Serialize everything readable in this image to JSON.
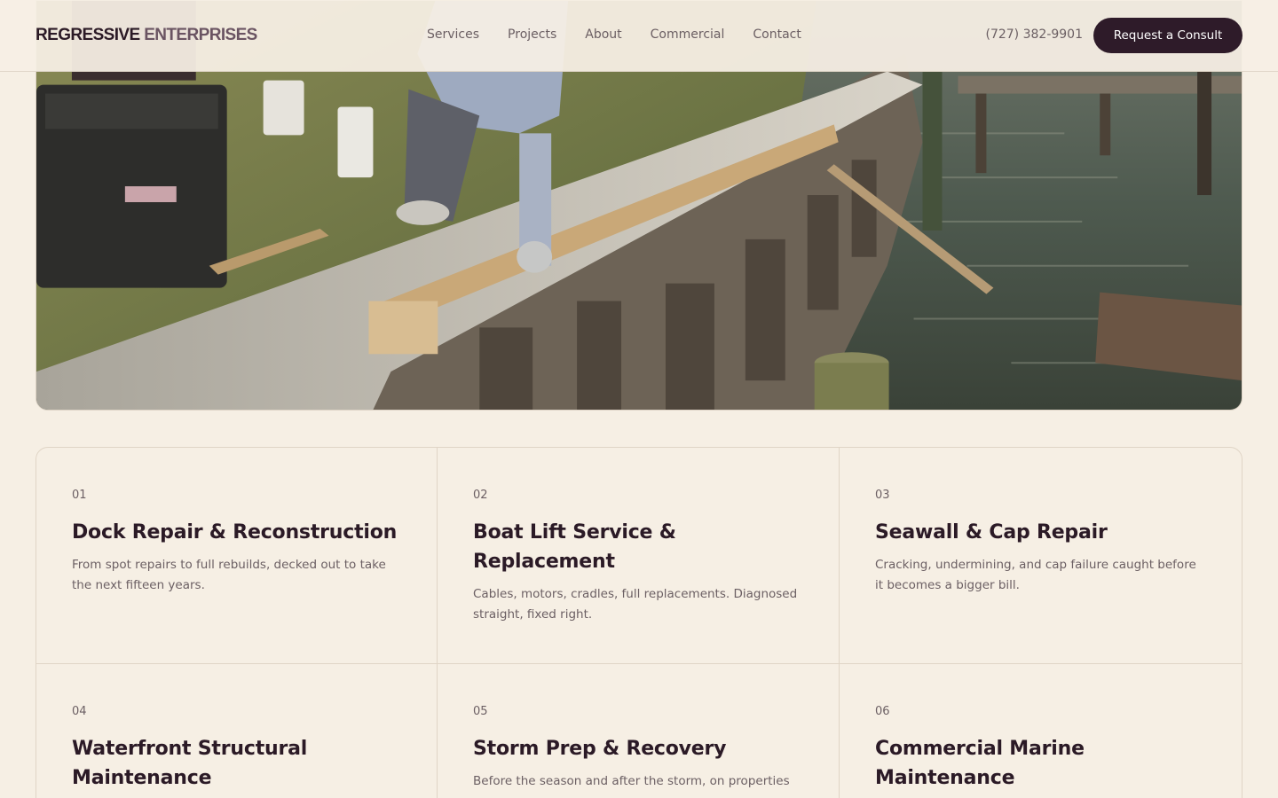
{
  "header": {
    "brand_part1": "REGRESSIVE",
    "brand_part2": "ENTERPRISES",
    "nav": [
      "Services",
      "Projects",
      "About",
      "Commercial",
      "Contact"
    ],
    "phone": "(727) 382-9901",
    "cta_label": "Request a Consult"
  },
  "hero": {
    "image_subject": "seawall-construction-photo"
  },
  "services": [
    {
      "num": "01",
      "title": "Dock Repair & Reconstruction",
      "desc": "From spot repairs to full rebuilds, decked out to take the next fifteen years."
    },
    {
      "num": "02",
      "title": "Boat Lift Service & Replacement",
      "desc": "Cables, motors, cradles, full replacements. Diagnosed straight, fixed right."
    },
    {
      "num": "03",
      "title": "Seawall & Cap Repair",
      "desc": "Cracking, undermining, and cap failure caught before it becomes a bigger bill."
    },
    {
      "num": "04",
      "title": "Waterfront Structural Maintenance",
      "desc": ""
    },
    {
      "num": "05",
      "title": "Storm Prep & Recovery",
      "desc": "Before the season and after the storm, on properties"
    },
    {
      "num": "06",
      "title": "Commercial Marine Maintenance",
      "desc": ""
    }
  ],
  "colors": {
    "background": "#f6efe4",
    "accent": "#2e1b29",
    "text_muted": "#6b5f63"
  }
}
